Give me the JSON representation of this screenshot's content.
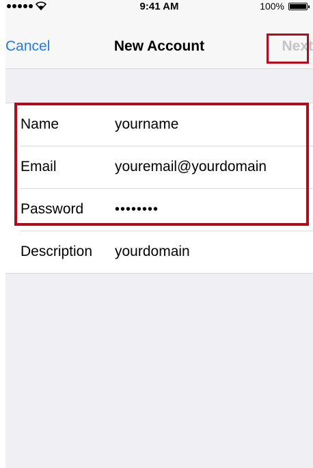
{
  "status_bar": {
    "time": "9:41 AM",
    "battery_percent": "100%",
    "wifi_icon": "wifi-icon",
    "battery_icon": "battery-icon"
  },
  "nav": {
    "cancel_label": "Cancel",
    "title": "New Account",
    "next_label": "Next"
  },
  "form": {
    "rows": [
      {
        "label": "Name",
        "value": "yourname"
      },
      {
        "label": "Email",
        "value": "youremail@yourdomain"
      },
      {
        "label": "Password",
        "value": "••••••••"
      },
      {
        "label": "Description",
        "value": "yourdomain"
      }
    ]
  },
  "colors": {
    "accent": "#1f7bf2",
    "highlight": "#b10c1c",
    "disabled": "#c4c4c6",
    "background": "#efeff4"
  }
}
